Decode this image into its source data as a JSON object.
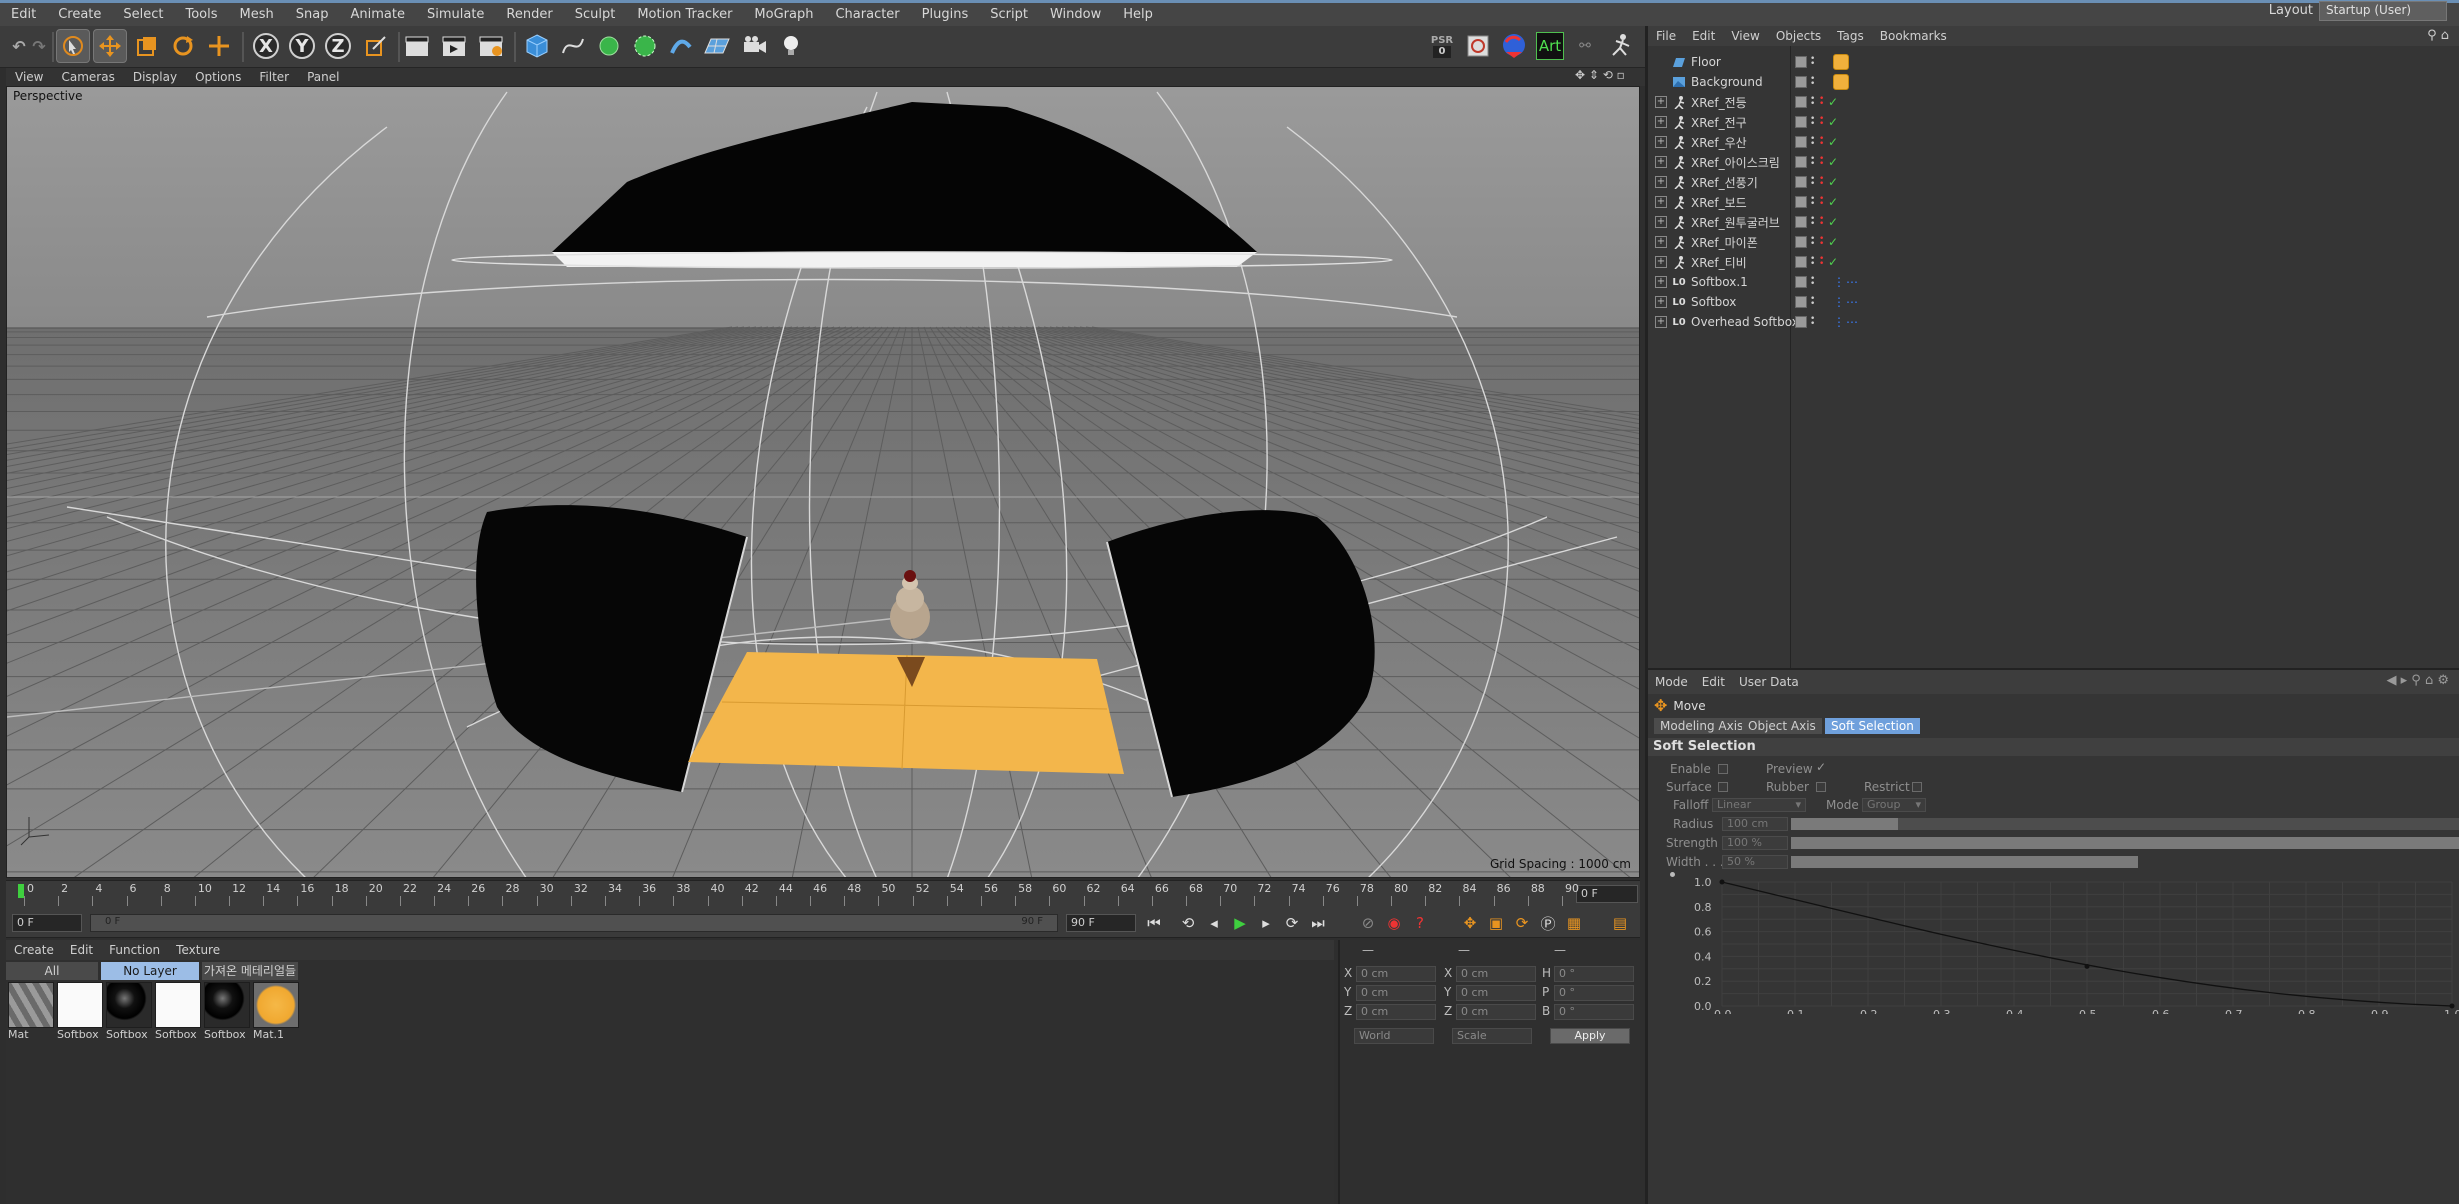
{
  "menubar": {
    "items": [
      "Edit",
      "Create",
      "Select",
      "Tools",
      "Mesh",
      "Snap",
      "Animate",
      "Simulate",
      "Render",
      "Sculpt",
      "Motion Tracker",
      "MoGraph",
      "Character",
      "Plugins",
      "Script",
      "Window",
      "Help"
    ],
    "layout_label": "Layout",
    "layout_value": "Startup (User)"
  },
  "toolbar": {
    "axis_x": "X",
    "axis_y": "Y",
    "axis_z": "Z",
    "art_label": "Art",
    "psr_label": "PSR",
    "psr_value": "0"
  },
  "viewport": {
    "menu": [
      "View",
      "Cameras",
      "Display",
      "Options",
      "Filter",
      "Panel"
    ],
    "label": "Perspective",
    "grid_spacing": "Grid Spacing : 1000 cm"
  },
  "timeline": {
    "ticks": [
      "0",
      "2",
      "4",
      "6",
      "8",
      "10",
      "12",
      "14",
      "16",
      "18",
      "20",
      "22",
      "24",
      "26",
      "28",
      "30",
      "32",
      "34",
      "36",
      "38",
      "40",
      "42",
      "44",
      "46",
      "48",
      "50",
      "52",
      "54",
      "56",
      "58",
      "60",
      "62",
      "64",
      "66",
      "68",
      "70",
      "72",
      "74",
      "76",
      "78",
      "80",
      "82",
      "84",
      "86",
      "88",
      "90"
    ],
    "current_frame": "0 F",
    "start_frame": "0 F",
    "range_start": "0 F",
    "range_end": "90 F",
    "end_frame": "90 F"
  },
  "materials": {
    "menu": [
      "Create",
      "Edit",
      "Function",
      "Texture"
    ],
    "layer_tabs": [
      "All",
      "No Layer",
      "가져온 메테리얼들"
    ],
    "items": [
      {
        "name": "Mat",
        "type": "striped"
      },
      {
        "name": "Softbox",
        "type": "white"
      },
      {
        "name": "Softbox",
        "type": "black-sphere"
      },
      {
        "name": "Softbox",
        "type": "white"
      },
      {
        "name": "Softbox",
        "type": "black-sphere"
      },
      {
        "name": "Mat.1",
        "type": "yellow"
      }
    ]
  },
  "coordinates": {
    "header": [
      "—",
      "—",
      "—"
    ],
    "rows": [
      {
        "a": "X",
        "av": "0 cm",
        "b": "X",
        "bv": "0 cm",
        "c": "H",
        "cv": "0 °"
      },
      {
        "a": "Y",
        "av": "0 cm",
        "b": "Y",
        "bv": "0 cm",
        "c": "P",
        "cv": "0 °"
      },
      {
        "a": "Z",
        "av": "0 cm",
        "b": "Z",
        "bv": "0 cm",
        "c": "B",
        "cv": "0 °"
      }
    ],
    "world": "World",
    "scale": "Scale",
    "apply": "Apply"
  },
  "objects": {
    "menu": [
      "File",
      "Edit",
      "View",
      "Objects",
      "Tags",
      "Bookmarks"
    ],
    "items": [
      {
        "name": "Floor",
        "icon": "floor",
        "expand": false,
        "check": false,
        "tag": "material"
      },
      {
        "name": "Background",
        "icon": "background",
        "expand": false,
        "check": false,
        "tag": "material"
      },
      {
        "name": "XRef_전등",
        "icon": "xref",
        "expand": true,
        "check": true,
        "tag": ""
      },
      {
        "name": "XRef_전구",
        "icon": "xref",
        "expand": true,
        "check": true,
        "tag": ""
      },
      {
        "name": "XRef_우산",
        "icon": "xref",
        "expand": true,
        "check": true,
        "tag": ""
      },
      {
        "name": "XRef_아이스크림",
        "icon": "xref",
        "expand": true,
        "check": true,
        "tag": ""
      },
      {
        "name": "XRef_선풍기",
        "icon": "xref",
        "expand": true,
        "check": true,
        "tag": ""
      },
      {
        "name": "XRef_보드",
        "icon": "xref",
        "expand": true,
        "check": true,
        "tag": ""
      },
      {
        "name": "XRef_원투굴러브",
        "icon": "xref",
        "expand": true,
        "check": true,
        "tag": ""
      },
      {
        "name": "XRef_마이폰",
        "icon": "xref",
        "expand": true,
        "check": true,
        "tag": ""
      },
      {
        "name": "XRef_티비",
        "icon": "xref",
        "expand": true,
        "check": true,
        "tag": ""
      },
      {
        "name": "Softbox.1",
        "icon": "lo",
        "expand": true,
        "check": false,
        "tag": "dots"
      },
      {
        "name": "Softbox",
        "icon": "lo",
        "expand": true,
        "check": false,
        "tag": "dots"
      },
      {
        "name": "Overhead Softbox",
        "icon": "lo",
        "expand": true,
        "check": false,
        "tag": "dots"
      }
    ]
  },
  "attributes": {
    "menu": [
      "Mode",
      "Edit",
      "User Data"
    ],
    "tool_name": "Move",
    "tabs": [
      "Modeling Axis",
      "Object Axis",
      "Soft Selection"
    ],
    "active_tab": 2,
    "section": "Soft Selection",
    "enable": "Enable",
    "preview": "Preview",
    "surface": "Surface",
    "rubber": "Rubber",
    "restrict": "Restrict",
    "falloff_label": "Falloff",
    "falloff_value": "Linear",
    "mode_label": "Mode",
    "mode_value": "Group",
    "radius_label": "Radius",
    "radius_value": "100 cm",
    "radius_fraction": 0.16,
    "strength_label": "Strength",
    "strength_value": "100 %",
    "strength_fraction": 1.0,
    "width_label": "Width . . .",
    "width_value": "50 %",
    "width_fraction": 0.5,
    "graph_y": [
      "1.0",
      "0.8",
      "0.6",
      "0.4",
      "0.2",
      "0.0"
    ],
    "graph_x": [
      "0.0",
      "0.1",
      "0.2",
      "0.3",
      "0.4",
      "0.5",
      "0.6",
      "0.7",
      "0.8",
      "0.9",
      "1.0"
    ]
  }
}
